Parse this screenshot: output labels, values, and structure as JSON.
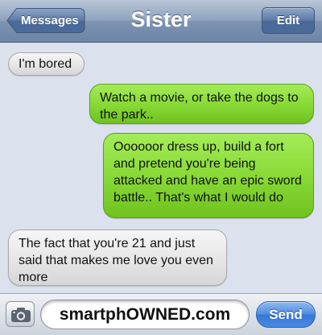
{
  "navbar": {
    "title": "Sister",
    "back_label": "Messages",
    "edit_label": "Edit"
  },
  "messages": [
    {
      "direction": "received",
      "text": "I'm bored"
    },
    {
      "direction": "sent",
      "text": "Watch a movie, or take the dogs to the park.."
    },
    {
      "direction": "sent",
      "text": "Oooooor dress up, build a fort and pretend you're being attacked and have an epic sword battle.. That's what I would do"
    },
    {
      "direction": "received",
      "text": "The fact that you're 21 and just said that makes me love you even more"
    }
  ],
  "input": {
    "value": "smartphOWNED.com",
    "send_label": "Send",
    "camera_icon": "camera-icon"
  },
  "colors": {
    "sent_bubble": "#86d834",
    "received_bubble": "#e4e4e4",
    "background": "#dbe2ed",
    "send_button": "#4f8ce0"
  }
}
